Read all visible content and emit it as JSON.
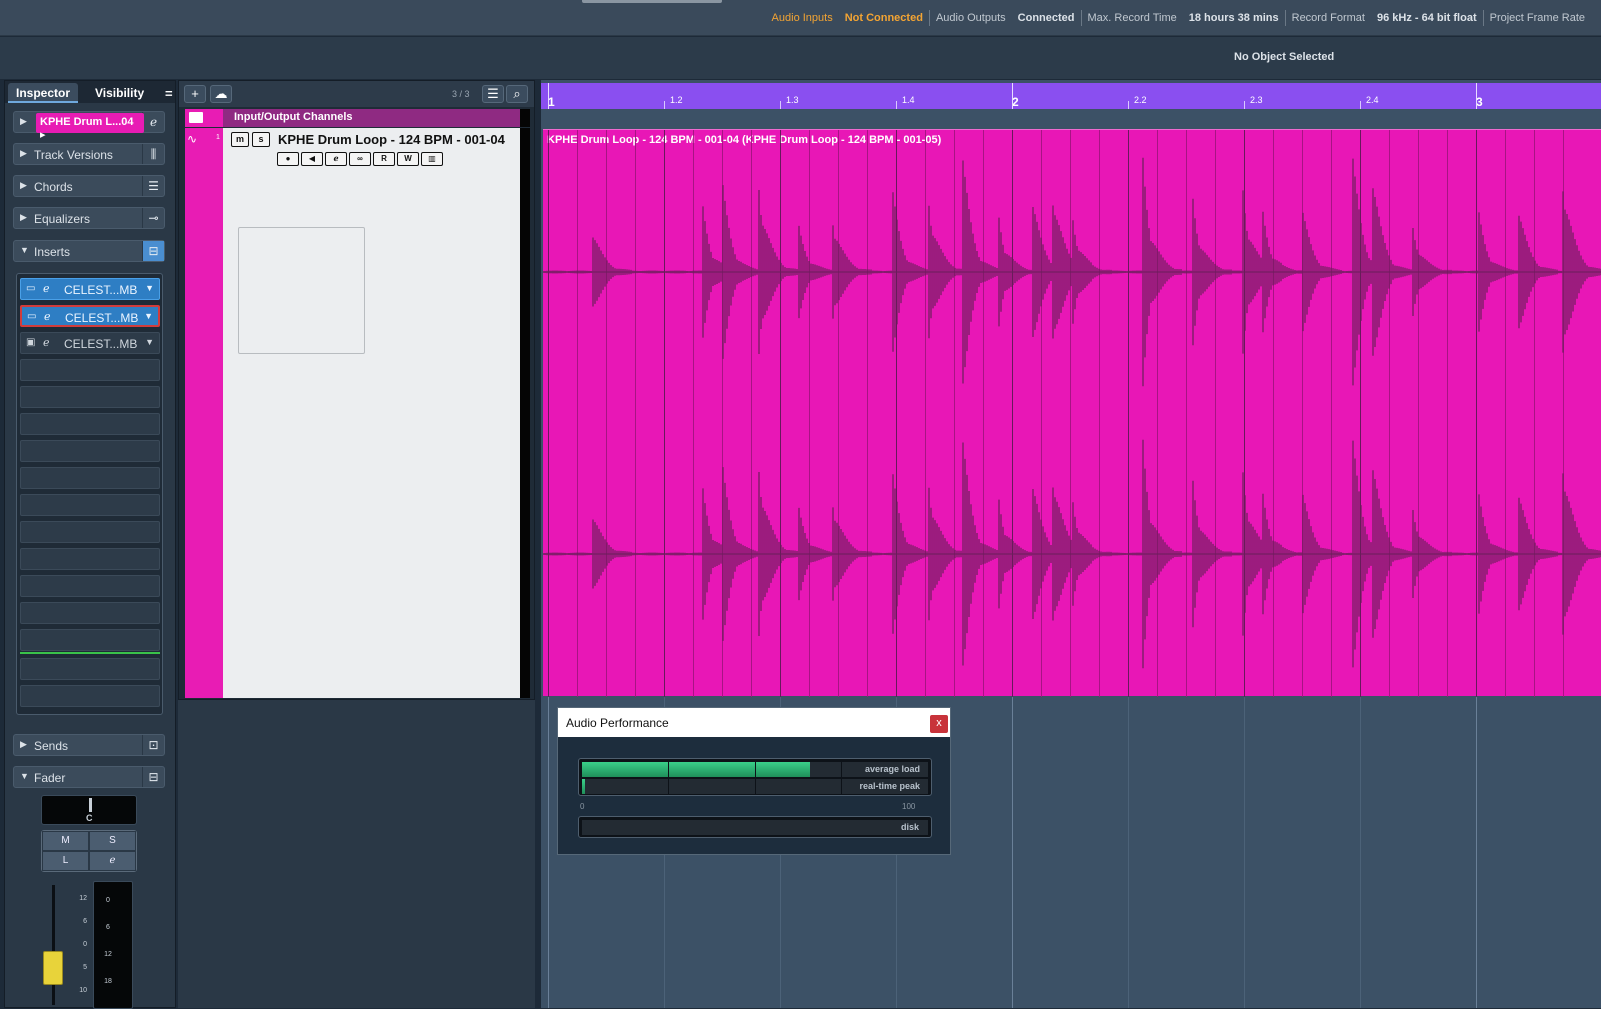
{
  "status_bar": {
    "audio_inputs_label": "Audio Inputs",
    "audio_inputs_value": "Not Connected",
    "audio_outputs_label": "Audio Outputs",
    "audio_outputs_value": "Connected",
    "max_record_label": "Max. Record Time",
    "max_record_value": "18 hours 38 mins",
    "record_format_label": "Record Format",
    "record_format_value": "96 kHz - 64 bit float",
    "frame_rate_label": "Project Frame Rate"
  },
  "info_line": {
    "text": "No Object Selected"
  },
  "inspector": {
    "tabs": [
      "Inspector",
      "Visibility"
    ],
    "menu_glyph": "=",
    "track_name": "KPHE Drum L...04 ▸",
    "sections": {
      "track_versions": "Track Versions",
      "chords": "Chords",
      "equalizers": "Equalizers",
      "inserts": "Inserts",
      "sends": "Sends",
      "fader": "Fader"
    },
    "insert_slots": [
      {
        "name": "CELEST...MB",
        "active": true,
        "selected": false
      },
      {
        "name": "CELEST...MB",
        "active": true,
        "selected": true
      },
      {
        "name": "CELEST...MB",
        "active": false,
        "selected": false
      }
    ],
    "pan_label": "C",
    "mute_label": "M",
    "solo_label": "S",
    "listen_label": "L",
    "fader_scale": [
      "12",
      "6",
      "0",
      "5",
      "10"
    ],
    "meter_scale": [
      "0",
      "6",
      "12",
      "18"
    ]
  },
  "track_list": {
    "count": "3 / 3",
    "folder_name": "Input/Output Channels",
    "track_number": "1",
    "track_name": "KPHE Drum Loop - 124 BPM - 001-04",
    "mute": "m",
    "solo": "s",
    "read": "R",
    "write": "W"
  },
  "ruler": {
    "markers": [
      {
        "label": "1",
        "major": true
      },
      {
        "label": "1.2",
        "major": false
      },
      {
        "label": "1.3",
        "major": false
      },
      {
        "label": "1.4",
        "major": false
      },
      {
        "label": "2",
        "major": true
      },
      {
        "label": "2.2",
        "major": false
      },
      {
        "label": "2.3",
        "major": false
      },
      {
        "label": "2.4",
        "major": false
      },
      {
        "label": "3",
        "major": true
      }
    ]
  },
  "event": {
    "title": "KPHE Drum Loop - 124 BPM - 001-04 (KPHE Drum Loop - 124 BPM - 001-05)",
    "color": "#e817b6"
  },
  "audio_performance": {
    "title": "Audio Performance",
    "close": "x",
    "average_load_label": "average load",
    "average_load": 0.66,
    "realtime_peak_label": "real-time peak",
    "realtime_peak": 0.01,
    "disk_label": "disk",
    "disk": 0.0,
    "scale_min": "0",
    "scale_max": "100"
  },
  "colors": {
    "accent": "#e81cb4",
    "ruler": "#8a4ff0",
    "meter": "#3ad08a"
  }
}
